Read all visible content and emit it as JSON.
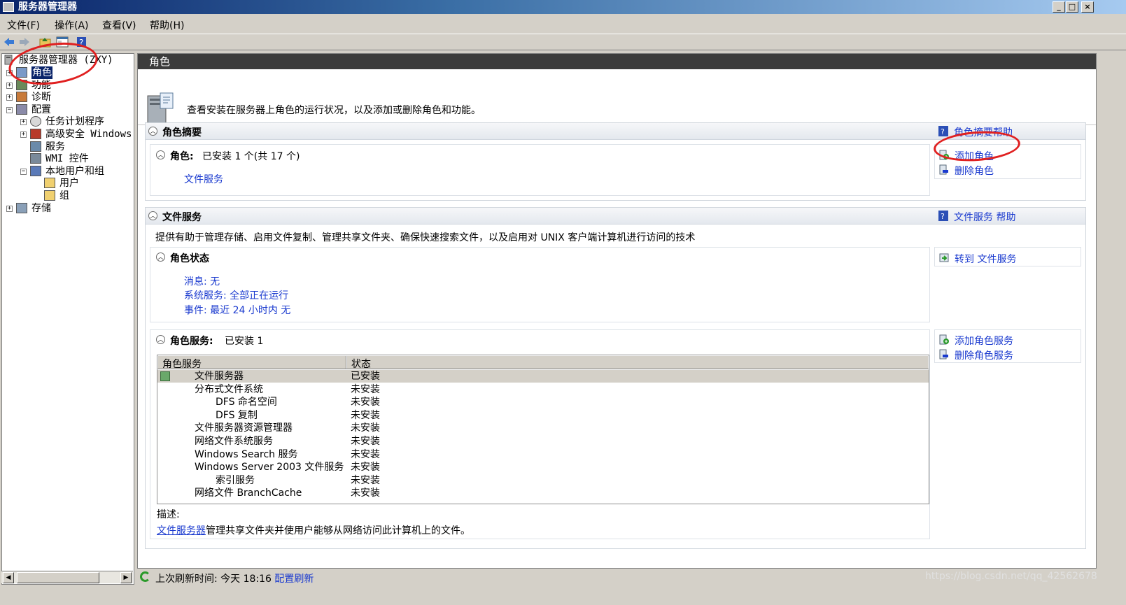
{
  "window": {
    "title": "服务器管理器",
    "controls": [
      "_",
      "□",
      "×"
    ]
  },
  "menu": [
    "文件(F)",
    "操作(A)",
    "查看(V)",
    "帮助(H)"
  ],
  "toolbar_icons": [
    "back-icon",
    "forward-icon",
    "folder-up-icon",
    "show-hide-icon",
    "help-icon"
  ],
  "tree": {
    "root": "服务器管理器 (ZXY)",
    "items": [
      {
        "label": "角色",
        "level": 1,
        "expander": "+",
        "icon": "roles-icon",
        "selected": true
      },
      {
        "label": "功能",
        "level": 1,
        "expander": "+",
        "icon": "features-icon"
      },
      {
        "label": "诊断",
        "level": 1,
        "expander": "+",
        "icon": "diagnostics-icon"
      },
      {
        "label": "配置",
        "level": 1,
        "expander": "-",
        "icon": "configuration-icon"
      },
      {
        "label": "任务计划程序",
        "level": 2,
        "expander": "+",
        "icon": "clock-icon"
      },
      {
        "label": "高级安全 Windows",
        "level": 2,
        "expander": "+",
        "icon": "firewall-icon"
      },
      {
        "label": "服务",
        "level": 2,
        "expander": "",
        "icon": "gear-icon"
      },
      {
        "label": "WMI 控件",
        "level": 2,
        "expander": "",
        "icon": "wmi-icon"
      },
      {
        "label": "本地用户和组",
        "level": 2,
        "expander": "-",
        "icon": "users-icon"
      },
      {
        "label": "用户",
        "level": 3,
        "expander": "",
        "icon": "folder-icon"
      },
      {
        "label": "组",
        "level": 3,
        "expander": "",
        "icon": "folder-icon"
      },
      {
        "label": "存储",
        "level": 1,
        "expander": "+",
        "icon": "storage-icon"
      }
    ]
  },
  "main": {
    "header": "角色",
    "intro": "查看安装在服务器上角色的运行状况，以及添加或删除角色和功能。",
    "roles_summary": {
      "title": "角色摘要",
      "help_link": "角色摘要帮助",
      "roles_title": "角色:",
      "roles_count": "已安装 1 个(共 17 个)",
      "installed_role": "文件服务",
      "tasks": [
        "添加角色",
        "删除角色"
      ]
    },
    "file_services": {
      "title": "文件服务",
      "help_link": "文件服务 帮助",
      "description": "提供有助于管理存储、启用文件复制、管理共享文件夹、确保快速搜索文件，以及启用对 UNIX 客户端计算机进行访问的技术",
      "status_title": "角色状态",
      "goto_task": "转到 文件服务",
      "status_lines": [
        "消息: 无",
        "系统服务: 全部正在运行",
        "事件: 最近 24 小时内 无"
      ],
      "services_title": "角色服务:",
      "services_count": "已安装 1",
      "service_tasks": [
        "添加角色服务",
        "删除角色服务"
      ],
      "table_headers": [
        "角色服务",
        "状态"
      ],
      "table_rows": [
        {
          "name": "文件服务器",
          "status": "已安装",
          "indent": 1
        },
        {
          "name": "分布式文件系统",
          "status": "未安装",
          "indent": 1
        },
        {
          "name": "DFS 命名空间",
          "status": "未安装",
          "indent": 2
        },
        {
          "name": "DFS 复制",
          "status": "未安装",
          "indent": 2
        },
        {
          "name": "文件服务器资源管理器",
          "status": "未安装",
          "indent": 1
        },
        {
          "name": "网络文件系统服务",
          "status": "未安装",
          "indent": 1
        },
        {
          "name": "Windows Search 服务",
          "status": "未安装",
          "indent": 1
        },
        {
          "name": "Windows Server 2003 文件服务",
          "status": "未安装",
          "indent": 1
        },
        {
          "name": "索引服务",
          "status": "未安装",
          "indent": 2
        },
        {
          "name": "网络文件 BranchCache",
          "status": "未安装",
          "indent": 1
        }
      ],
      "desc_label": "描述:",
      "desc_link": "文件服务器",
      "desc_text": "管理共享文件夹并使用户能够从网络访问此计算机上的文件。"
    }
  },
  "statusbar": {
    "text": "上次刷新时间: 今天 18:16",
    "link": "配置刷新"
  },
  "watermark": "https://blog.csdn.net/qq_42562678",
  "colors": {
    "link": "#1a3acf",
    "header": "#3c3c3c",
    "selection": "#0a246a",
    "annotation": "#e02020"
  }
}
